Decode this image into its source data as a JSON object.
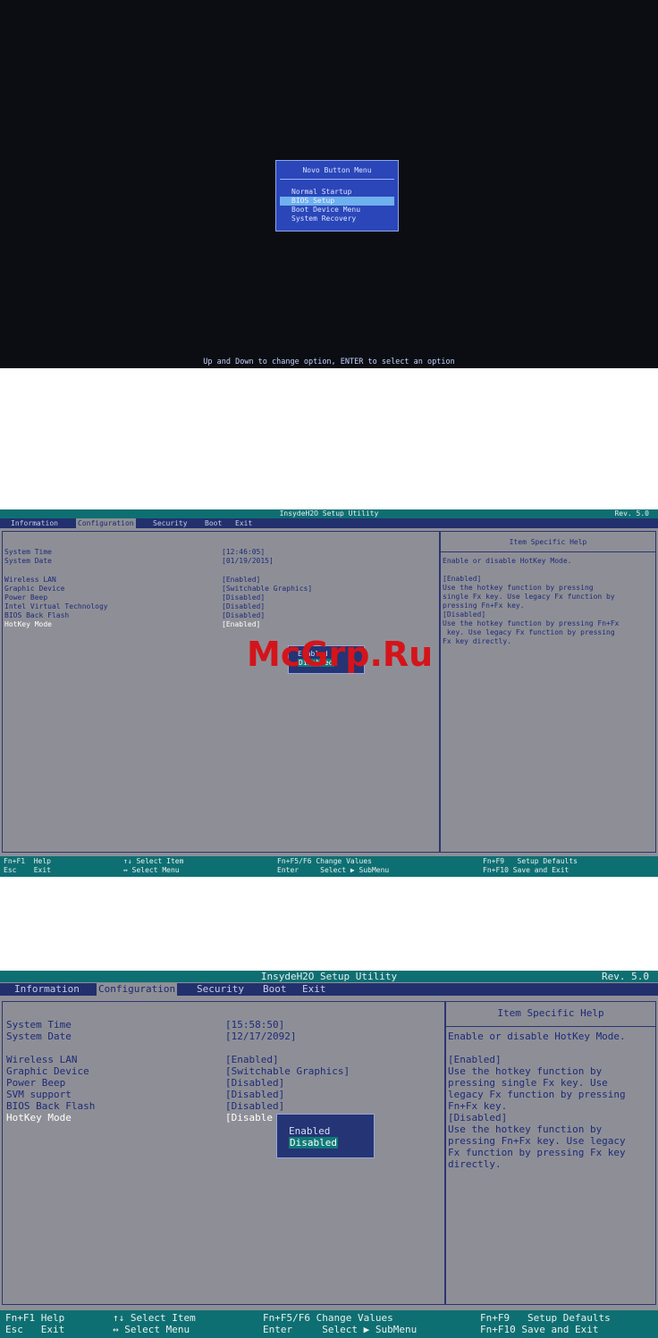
{
  "novo_screen": {
    "menu_title": "Novo Button Menu",
    "items": [
      "Normal Startup",
      "BIOS Setup",
      "Boot Device Menu",
      "System Recovery"
    ],
    "selected_index": 1,
    "hint": "Up and Down to change option, ENTER to select an option"
  },
  "bios_screens": [
    {
      "title": "InsydeH2O Setup Utility",
      "rev": "Rev. 5.0",
      "tabs": [
        "Information",
        "Configuration",
        "Security",
        "Boot",
        "Exit"
      ],
      "active_tab": "Configuration",
      "settings": [
        {
          "label": "System Time",
          "value": "[12:46:05]"
        },
        {
          "label": "System Date",
          "value": "[01/19/2015]"
        },
        {
          "label": "Wireless LAN",
          "value": "[Enabled]"
        },
        {
          "label": "Graphic Device",
          "value": "[Switchable Graphics]"
        },
        {
          "label": "Power Beep",
          "value": "[Disabled]"
        },
        {
          "label": "Intel Virtual Technology",
          "value": "[Disabled]"
        },
        {
          "label": "BIOS Back Flash",
          "value": "[Disabled]"
        },
        {
          "label": "HotKey Mode",
          "value": "[Enabled]"
        }
      ],
      "help_title": "Item Specific Help",
      "help_lines": [
        "Enable or disable HotKey Mode.",
        "",
        "[Enabled]",
        "Use the hotkey function by pressing",
        "single Fx key. Use legacy Fx function by",
        "pressing Fn+Fx key.",
        "[Disabled]",
        "Use the hotkey function by pressing Fn+Fx",
        " key. Use legacy Fx function by pressing",
        "Fx key directly."
      ],
      "popup_options": [
        "Enabled",
        "Disabled"
      ],
      "popup_selected": 1,
      "footer": [
        [
          "Fn+F1  Help",
          "Esc    Exit"
        ],
        [
          "↑↓ Select Item",
          "↔ Select Menu"
        ],
        [
          "Fn+F5/F6 Change Values",
          "Enter     Select ▶ SubMenu"
        ],
        [
          "Fn+F9   Setup Defaults",
          "Fn+F10 Save and Exit"
        ]
      ]
    },
    {
      "title": "InsydeH2O Setup Utility",
      "rev": "Rev. 5.0",
      "tabs": [
        "Information",
        "Configuration",
        "Security",
        "Boot",
        "Exit"
      ],
      "active_tab": "Configuration",
      "settings": [
        {
          "label": "System Time",
          "value": "[15:58:50]"
        },
        {
          "label": "System Date",
          "value": "[12/17/2092]"
        },
        {
          "label": "Wireless LAN",
          "value": "[Enabled]"
        },
        {
          "label": "Graphic Device",
          "value": "[Switchable Graphics]"
        },
        {
          "label": "Power Beep",
          "value": "[Disabled]"
        },
        {
          "label": "SVM support",
          "value": "[Disabled]"
        },
        {
          "label": "BIOS Back Flash",
          "value": "[Disabled]"
        },
        {
          "label": "HotKey Mode",
          "value": "[Disable"
        }
      ],
      "help_title": "Item Specific Help",
      "help_lines": [
        "Enable or disable HotKey Mode.",
        "",
        "[Enabled]",
        "Use the hotkey function by",
        "pressing single Fx key. Use",
        "legacy Fx function by pressing",
        "Fn+Fx key.",
        "[Disabled]",
        "Use the hotkey function by",
        "pressing Fn+Fx key. Use legacy",
        "Fx function by pressing Fx key",
        "directly."
      ],
      "popup_options": [
        "Enabled",
        "Disabled"
      ],
      "popup_selected": 1,
      "footer": [
        [
          "Fn+F1 Help",
          "Esc   Exit"
        ],
        [
          "↑↓ Select Item",
          "↔ Select Menu"
        ],
        [
          "Fn+F5/F6 Change Values",
          "Enter     Select ▶ SubMenu"
        ],
        [
          "Fn+F9   Setup Defaults",
          "Fn+F10 Save and Exit"
        ]
      ]
    }
  ],
  "watermark": "McGrp.Ru"
}
